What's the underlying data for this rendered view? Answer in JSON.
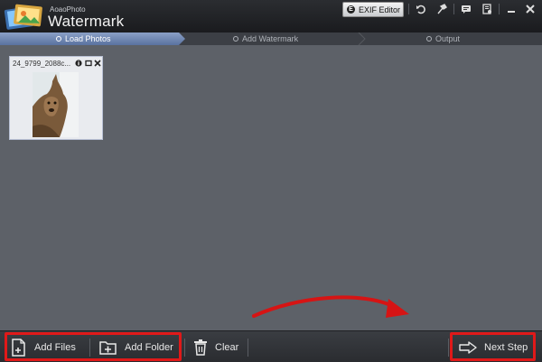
{
  "app": {
    "brand_small": "AoaoPhoto",
    "brand_name": "Watermark"
  },
  "titlebar": {
    "exif_editor_label": "EXIF Editor",
    "icons": [
      "undo-icon",
      "tools-icon",
      "feedback-icon",
      "register-icon",
      "minimize-icon",
      "close-icon"
    ]
  },
  "steps": [
    {
      "label": "Load Photos",
      "active": true
    },
    {
      "label": "Add Watermark",
      "active": false
    },
    {
      "label": "Output",
      "active": false
    }
  ],
  "photos": [
    {
      "filename": "24_9799_2088c..."
    }
  ],
  "toolbar": {
    "add_files_label": "Add Files",
    "add_folder_label": "Add Folder",
    "clear_label": "Clear",
    "next_step_label": "Next Step"
  },
  "colors": {
    "accent_step": "#6d85ad",
    "annotation_red": "#e01919",
    "workspace": "#5d6168"
  }
}
